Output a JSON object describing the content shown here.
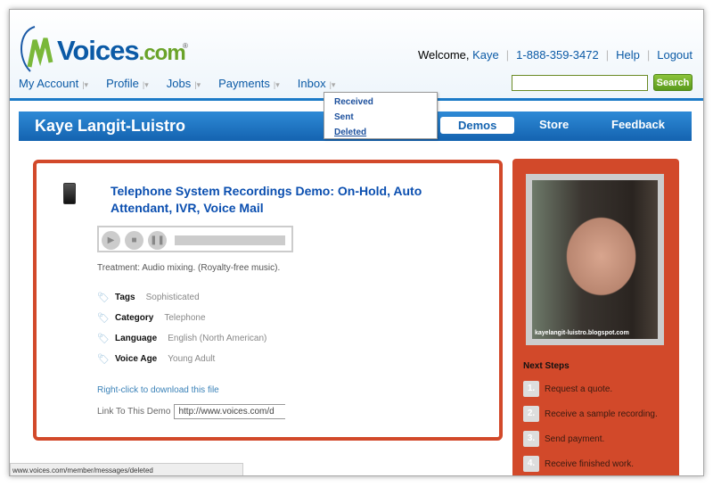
{
  "header": {
    "logo_main": "Voices",
    "logo_tld": ".com",
    "logo_reg": "®",
    "welcome": "Welcome,",
    "user": "Kaye",
    "phone": "1-888-359-3472",
    "help": "Help",
    "logout": "Logout"
  },
  "nav": [
    {
      "label": "My Account"
    },
    {
      "label": "Profile"
    },
    {
      "label": "Jobs"
    },
    {
      "label": "Payments"
    },
    {
      "label": "Inbox"
    }
  ],
  "search": {
    "value": "",
    "button": "Search"
  },
  "inbox_menu": [
    "Received",
    "Sent",
    "Deleted"
  ],
  "profile_bar": {
    "name": "Kaye Langit-Luistro",
    "tabs": [
      "Demos",
      "Store",
      "Feedback"
    ]
  },
  "demo": {
    "title": "Telephone System Recordings Demo: On-Hold, Auto Attendant, IVR, Voice Mail",
    "treatment": "Treatment: Audio mixing. (Royalty-free music).",
    "meta": [
      {
        "k": "Tags",
        "v": "Sophisticated"
      },
      {
        "k": "Category",
        "v": "Telephone"
      },
      {
        "k": "Language",
        "v": "English (North American)"
      },
      {
        "k": "Voice Age",
        "v": "Young Adult"
      }
    ],
    "download": "Right-click to download this file",
    "link_label": "Link To This Demo",
    "link_value": "http://www.voices.com/d"
  },
  "sidebar": {
    "watermark": "kayelangit-luistro.blogspot.com",
    "next_steps": "Next Steps",
    "steps": [
      {
        "n": "1.",
        "t": "Request a quote."
      },
      {
        "n": "2.",
        "t": "Receive a sample recording."
      },
      {
        "n": "3.",
        "t": "Send payment."
      },
      {
        "n": "4.",
        "t": "Receive finished work."
      }
    ]
  },
  "status_bar": "www.voices.com/member/messages/deleted"
}
